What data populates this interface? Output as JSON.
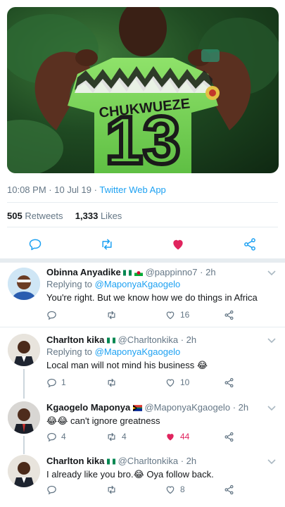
{
  "tweet": {
    "photo": {
      "jersey_name": "CHUKWUEZE",
      "jersey_number": "13",
      "colors": {
        "jersey": "#7ed957",
        "pattern": "#1f1f1f",
        "skin": "#5a3020",
        "background": "#1f4a22"
      }
    },
    "time": "10:08 PM",
    "date": "10 Jul 19",
    "separator": "·",
    "app": "Twitter Web App",
    "retweets_count": "505",
    "retweets_label": "Retweets",
    "likes_count": "1,333",
    "likes_label": "Likes",
    "actions": [
      {
        "icon": "reply-icon"
      },
      {
        "icon": "retweet-icon"
      },
      {
        "icon": "heart-filled-icon",
        "active": true,
        "color": "#e0245e"
      },
      {
        "icon": "share-icon"
      }
    ]
  },
  "replies": [
    {
      "name": "Obinna Anyadike",
      "flags": [
        "nigeria-flag",
        "wales-flag"
      ],
      "handle": "@pappinno7",
      "time": "2h",
      "replying_prefix": "Replying to",
      "replying_to": "@MaponyaKgaogelo",
      "text": "You're right. But we know how we do things in Africa",
      "reply_count": "",
      "retweet_count": "",
      "like_count": "16",
      "liked": false
    },
    {
      "name": "Charlton kika",
      "flags": [
        "nigeria-flag"
      ],
      "handle": "@Charltonkika",
      "time": "2h",
      "replying_prefix": "Replying to",
      "replying_to": "@MaponyaKgaogelo",
      "text": "Local man will not mind his business 😂",
      "reply_count": "1",
      "retweet_count": "",
      "like_count": "10",
      "liked": false
    },
    {
      "name": "Kgaogelo Maponya",
      "flags": [
        "south-africa-flag"
      ],
      "handle": "@MaponyaKgaogelo",
      "time": "2h",
      "text": "😂😂 can't ignore greatness",
      "reply_count": "4",
      "retweet_count": "4",
      "like_count": "44",
      "liked": true
    },
    {
      "name": "Charlton kika",
      "flags": [
        "nigeria-flag"
      ],
      "handle": "@Charltonkika",
      "time": "2h",
      "text": "I already like you bro.😂 Oya follow back.",
      "reply_count": "",
      "retweet_count": "",
      "like_count": "8",
      "liked": false
    }
  ],
  "ui": {
    "accent": "#1da1f2",
    "like_color": "#e0245e",
    "muted": "#657786",
    "dot": "·"
  }
}
